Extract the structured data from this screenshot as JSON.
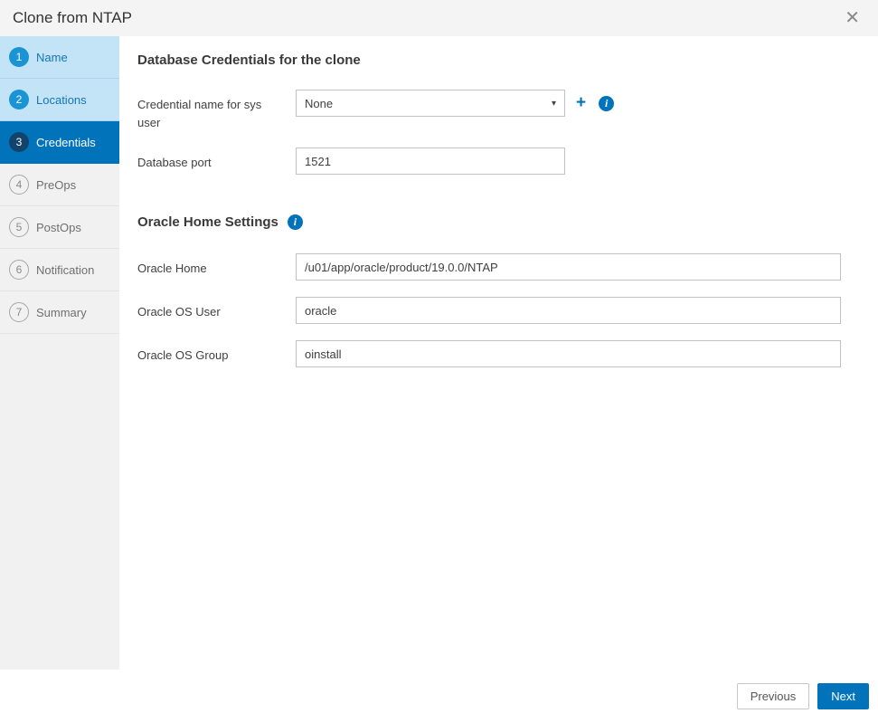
{
  "window": {
    "title": "Clone from NTAP",
    "close_icon": "✕"
  },
  "sidebar": {
    "steps": [
      {
        "number": "1",
        "label": "Name",
        "state": "done"
      },
      {
        "number": "2",
        "label": "Locations",
        "state": "done"
      },
      {
        "number": "3",
        "label": "Credentials",
        "state": "active"
      },
      {
        "number": "4",
        "label": "PreOps",
        "state": "todo"
      },
      {
        "number": "5",
        "label": "PostOps",
        "state": "todo"
      },
      {
        "number": "6",
        "label": "Notification",
        "state": "todo"
      },
      {
        "number": "7",
        "label": "Summary",
        "state": "todo"
      }
    ]
  },
  "content": {
    "credentials_section": {
      "title": "Database Credentials for the clone",
      "credential_field": {
        "label": "Credential name for sys user",
        "value": "None"
      },
      "port_field": {
        "label": "Database port",
        "value": "1521"
      }
    },
    "oracle_section": {
      "title": "Oracle Home Settings",
      "home_field": {
        "label": "Oracle Home",
        "value": "/u01/app/oracle/product/19.0.0/NTAP"
      },
      "user_field": {
        "label": "Oracle OS User",
        "value": "oracle"
      },
      "group_field": {
        "label": "Oracle OS Group",
        "value": "oinstall"
      }
    }
  },
  "icons": {
    "plus": "+",
    "info": "i",
    "caret": "▾"
  },
  "footer": {
    "previous_label": "Previous",
    "next_label": "Next"
  },
  "colors": {
    "accent_blue": "#0073bb",
    "done_step_bg": "#c3e3f6",
    "active_step_bg": "#0073bb",
    "active_step_circle": "#12436b",
    "header_bg": "#f4f4f4",
    "sidebar_bg": "#f1f1f1",
    "next_button_bg": "#0073bb"
  }
}
